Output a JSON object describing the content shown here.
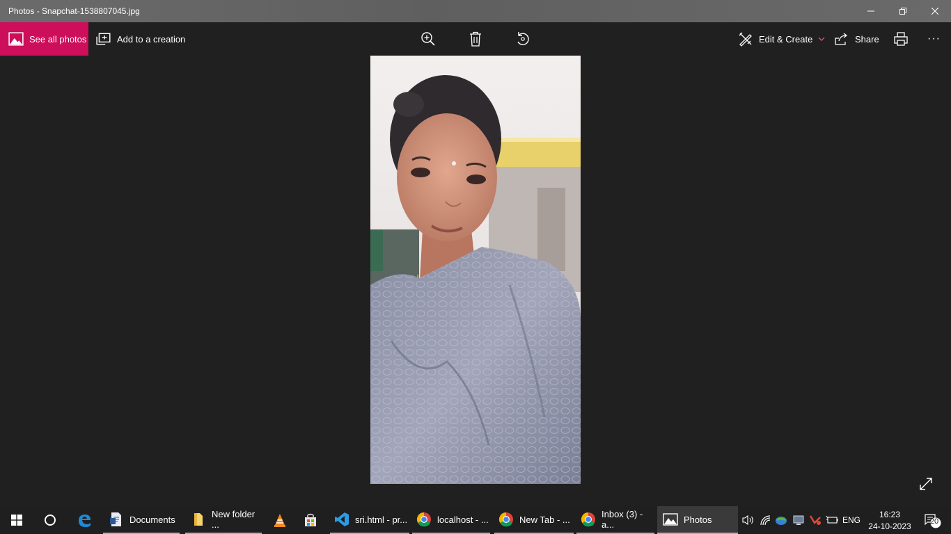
{
  "window": {
    "title": "Photos - Snapchat-1538807045.jpg"
  },
  "toolbar": {
    "see_all_label": "See all photos",
    "add_creation_label": "Add to a creation",
    "edit_create_label": "Edit & Create",
    "share_label": "Share",
    "more_label": "···",
    "accent": "#cc0e5b"
  },
  "taskbar": {
    "apps": [
      {
        "label": "Documents"
      },
      {
        "label": "New folder ..."
      },
      {
        "label": "sri.html - pr..."
      },
      {
        "label": "localhost - ..."
      },
      {
        "label": "New Tab - ..."
      },
      {
        "label": "Inbox (3) - a..."
      },
      {
        "label": "Photos"
      }
    ],
    "tray": {
      "language": "ENG",
      "time": "16:23",
      "date": "24-10-2023",
      "notification_count": "20"
    }
  }
}
